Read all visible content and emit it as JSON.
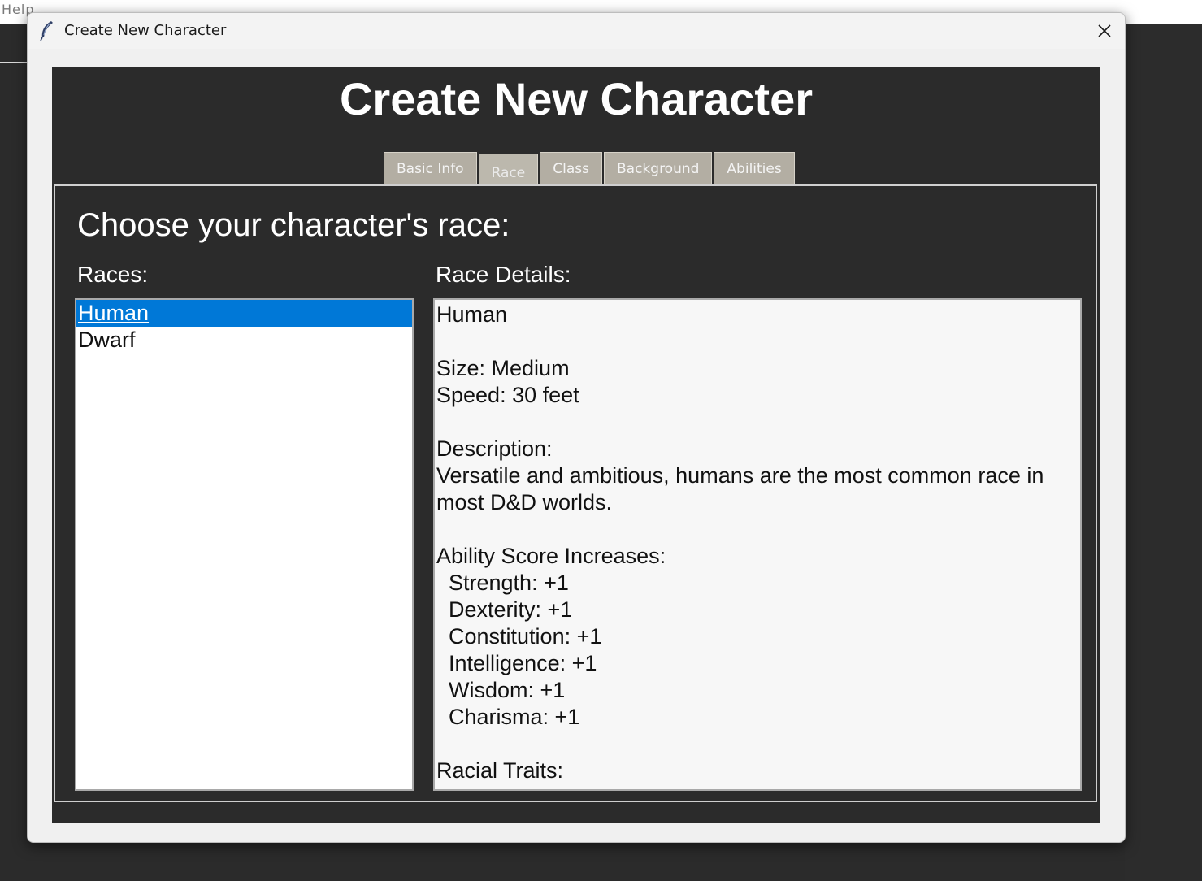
{
  "background_app": {
    "menu_fragment": "Help"
  },
  "window": {
    "title": "Create New Character",
    "icon": "feather-icon",
    "close_icon": "close-icon"
  },
  "main": {
    "heading": "Create New Character",
    "tabs": [
      {
        "label": "Basic Info",
        "active": false
      },
      {
        "label": "Race",
        "active": true
      },
      {
        "label": "Class",
        "active": false
      },
      {
        "label": "Background",
        "active": false
      },
      {
        "label": "Abilities",
        "active": false
      }
    ],
    "race_panel": {
      "heading": "Choose your character's race:",
      "races_label": "Races:",
      "details_label": "Race Details:",
      "races": [
        {
          "name": "Human",
          "selected": true
        },
        {
          "name": "Dwarf",
          "selected": false
        }
      ],
      "details": {
        "name": "Human",
        "size": "Size: Medium",
        "speed": "Speed: 30 feet",
        "description_label": "Description:",
        "description_line1": "Versatile and ambitious, humans are the most common race in",
        "description_line2": "most D&D worlds.",
        "ability_label": "Ability Score Increases:",
        "abilities": [
          "Strength: +1",
          "Dexterity: +1",
          "Constitution: +1",
          "Intelligence: +1",
          "Wisdom: +1",
          "Charisma: +1"
        ],
        "traits_label": "Racial Traits:"
      }
    }
  },
  "colors": {
    "dark_bg": "#2b2b2b",
    "tab_bg": "#b3aea3",
    "selection": "#0078d7"
  }
}
